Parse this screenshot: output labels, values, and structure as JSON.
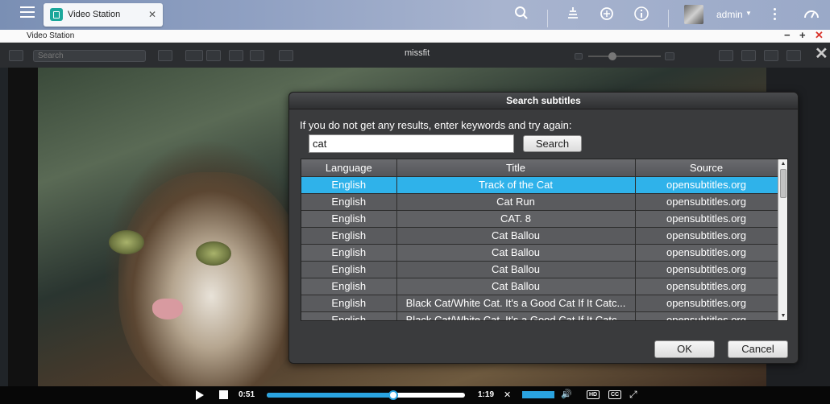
{
  "topbar": {
    "tab_label": "Video Station",
    "user_name": "admin"
  },
  "app": {
    "title": "Video Station",
    "movie_title": "missfit",
    "search_placeholder": "Search"
  },
  "dialog": {
    "title": "Search subtitles",
    "instruction": "If you do not get any results, enter keywords and try again:",
    "keyword_value": "cat",
    "search_label": "Search",
    "columns": [
      "Language",
      "Title",
      "Source"
    ],
    "rows": [
      {
        "language": "English",
        "title": "Track of the Cat",
        "source": "opensubtitles.org",
        "selected": true
      },
      {
        "language": "English",
        "title": "Cat Run",
        "source": "opensubtitles.org",
        "selected": false
      },
      {
        "language": "English",
        "title": "CAT. 8",
        "source": "opensubtitles.org",
        "selected": false
      },
      {
        "language": "English",
        "title": "Cat Ballou",
        "source": "opensubtitles.org",
        "selected": false
      },
      {
        "language": "English",
        "title": "Cat Ballou",
        "source": "opensubtitles.org",
        "selected": false
      },
      {
        "language": "English",
        "title": "Cat Ballou",
        "source": "opensubtitles.org",
        "selected": false
      },
      {
        "language": "English",
        "title": "Cat Ballou",
        "source": "opensubtitles.org",
        "selected": false
      },
      {
        "language": "English",
        "title": "Black Cat/White Cat. It's a Good Cat If It Catc...",
        "source": "opensubtitles.org",
        "selected": false
      },
      {
        "language": "English",
        "title": "Black Cat/White Cat. It's a Good Cat If It Catc...",
        "source": "opensubtitles.org",
        "selected": false
      }
    ],
    "ok_label": "OK",
    "cancel_label": "Cancel"
  },
  "player": {
    "current_time": "0:51",
    "total_time": "1:19",
    "progress_fraction": 0.64,
    "volume_fraction": 1.0,
    "hd_label": "HD",
    "cc_label": "CC"
  },
  "colors": {
    "accent": "#2fb2ea",
    "selected_row": "#2fb2ea",
    "dialog_bg": "#3a3b3d"
  },
  "icons": {
    "search": "search-icon",
    "download_tasks": "download-tasks-icon",
    "refresh": "refresh-icon",
    "info": "info-icon",
    "dashboard": "dashboard-icon"
  }
}
